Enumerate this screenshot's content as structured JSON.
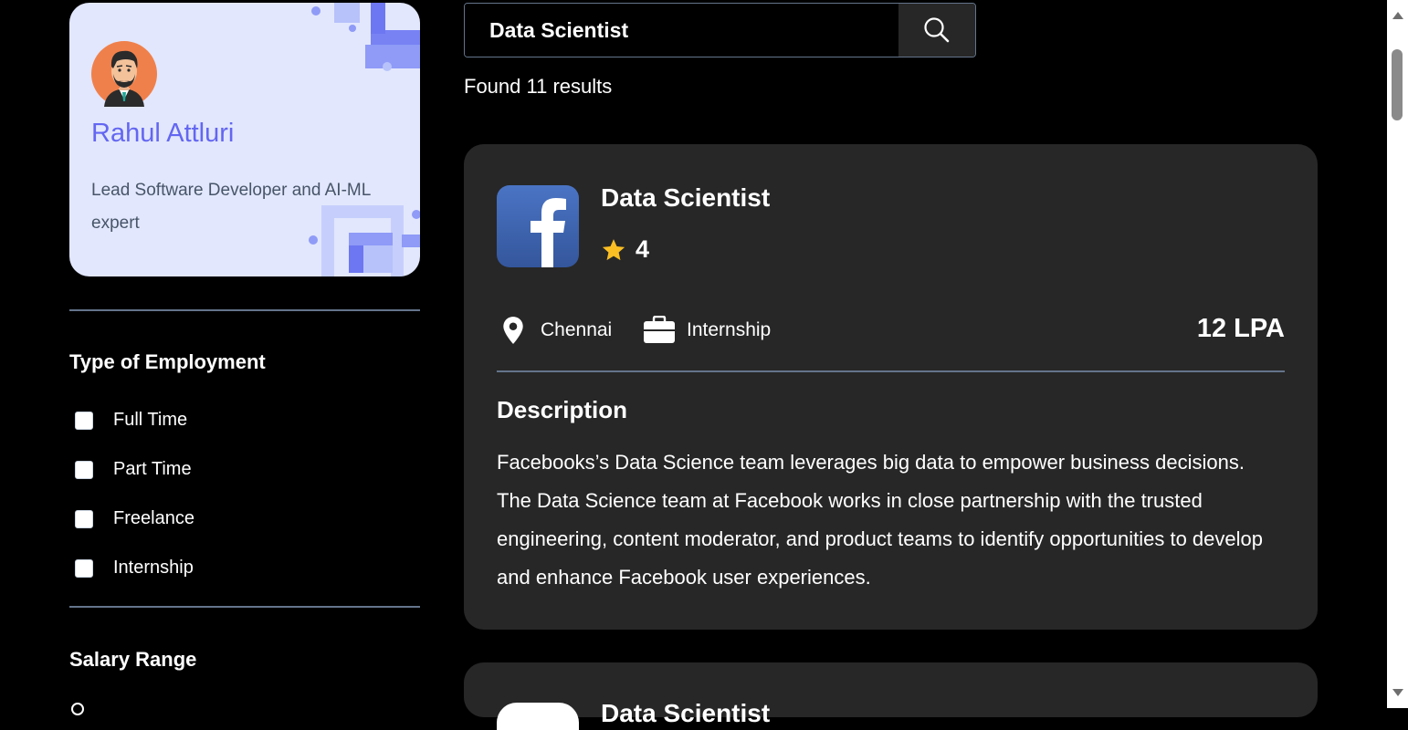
{
  "profile": {
    "name": "Rahul Attluri",
    "bio": "Lead Software Developer and AI-ML expert",
    "avatar_icon": "man-avatar-icon"
  },
  "filters": {
    "employment_title": "Type of Employment",
    "employment_options": [
      {
        "label": "Full Time",
        "checked": false
      },
      {
        "label": "Part Time",
        "checked": false
      },
      {
        "label": "Freelance",
        "checked": false
      },
      {
        "label": "Internship",
        "checked": false
      }
    ],
    "salary_title": "Salary Range"
  },
  "search": {
    "value": "Data Scientist",
    "button_icon": "search-icon"
  },
  "results": {
    "count_text": "Found 11 results"
  },
  "jobs": [
    {
      "title": "Data Scientist",
      "company_icon": "facebook-logo",
      "rating": "4",
      "location": "Chennai",
      "employment_type": "Internship",
      "package": "12 LPA",
      "description_title": "Description",
      "description": "Facebooks’s Data Science team leverages big data to empower business decisions. The Data Science team at Facebook works in close partnership with the trusted engineering, content moderator, and product teams to identify opportunities to develop and enhance Facebook user experiences."
    },
    {
      "title": "Data Scientist"
    }
  ],
  "colors": {
    "background": "#000000",
    "profile_card": "#e2e7fd",
    "accent": "#6366f1",
    "job_card": "#272727",
    "divider": "#64748b",
    "star": "#fbbf24"
  }
}
